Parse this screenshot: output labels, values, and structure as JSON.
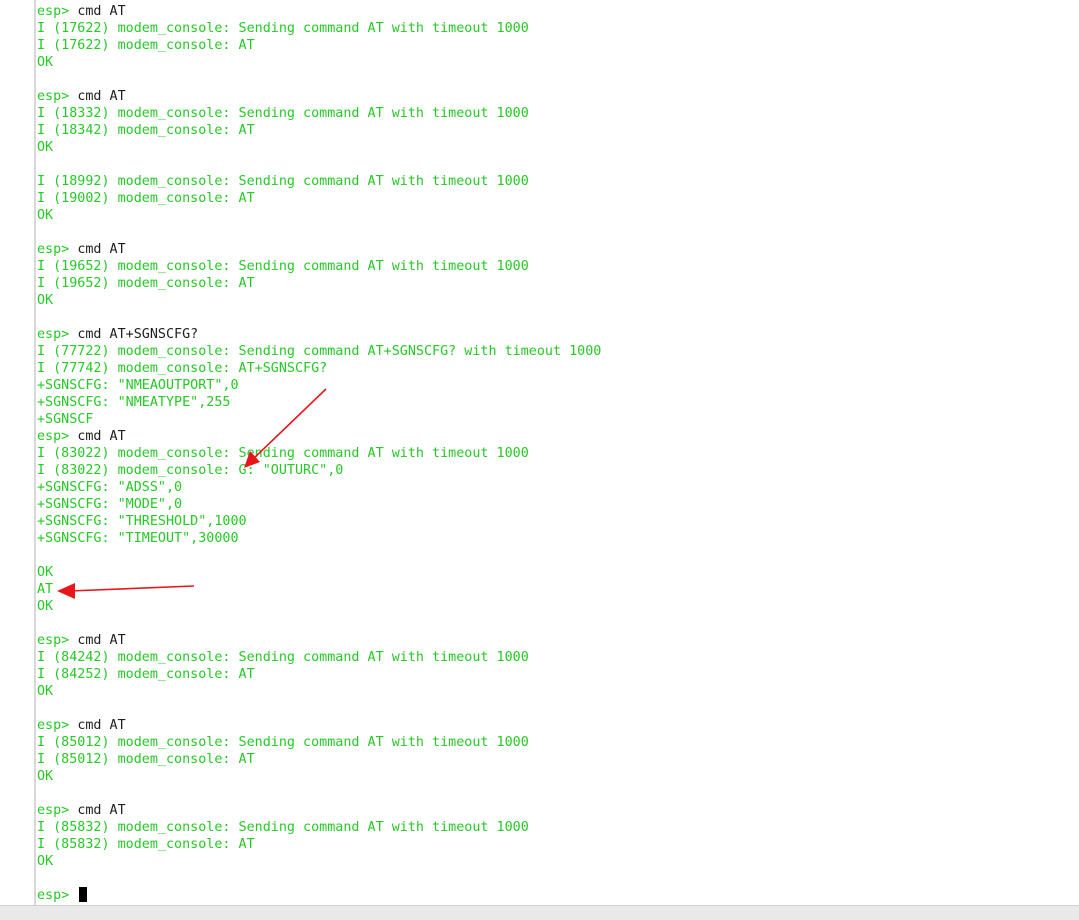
{
  "terminal": {
    "lines": [
      [
        {
          "t": "esp> ",
          "c": "green"
        },
        {
          "t": "cmd AT",
          "c": "black"
        }
      ],
      [
        {
          "t": "I (17622) modem_console: Sending command AT with timeout 1000",
          "c": "green"
        }
      ],
      [
        {
          "t": "I (17622) modem_console: AT",
          "c": "green"
        }
      ],
      [
        {
          "t": "OK",
          "c": "green"
        }
      ],
      [],
      [
        {
          "t": "esp> ",
          "c": "green"
        },
        {
          "t": "cmd AT",
          "c": "black"
        }
      ],
      [
        {
          "t": "I (18332) modem_console: Sending command AT with timeout 1000",
          "c": "green"
        }
      ],
      [
        {
          "t": "I (18342) modem_console: AT",
          "c": "green"
        }
      ],
      [
        {
          "t": "OK",
          "c": "green"
        }
      ],
      [],
      [
        {
          "t": "I (18992) modem_console: Sending command AT with timeout 1000",
          "c": "green"
        }
      ],
      [
        {
          "t": "I (19002) modem_console: AT",
          "c": "green"
        }
      ],
      [
        {
          "t": "OK",
          "c": "green"
        }
      ],
      [],
      [
        {
          "t": "esp> ",
          "c": "green"
        },
        {
          "t": "cmd AT",
          "c": "black"
        }
      ],
      [
        {
          "t": "I (19652) modem_console: Sending command AT with timeout 1000",
          "c": "green"
        }
      ],
      [
        {
          "t": "I (19652) modem_console: AT",
          "c": "green"
        }
      ],
      [
        {
          "t": "OK",
          "c": "green"
        }
      ],
      [],
      [
        {
          "t": "esp> ",
          "c": "green"
        },
        {
          "t": "cmd AT+SGNSCFG?",
          "c": "black"
        }
      ],
      [
        {
          "t": "I (77722) modem_console: Sending command AT+SGNSCFG? with timeout 1000",
          "c": "green"
        }
      ],
      [
        {
          "t": "I (77742) modem_console: AT+SGNSCFG?",
          "c": "green"
        }
      ],
      [
        {
          "t": "+SGNSCFG: \"NMEAOUTPORT\",0",
          "c": "green"
        }
      ],
      [
        {
          "t": "+SGNSCFG: \"NMEATYPE\",255",
          "c": "green"
        }
      ],
      [
        {
          "t": "+SGNSCF",
          "c": "green"
        }
      ],
      [
        {
          "t": "esp> ",
          "c": "green"
        },
        {
          "t": "cmd AT",
          "c": "black"
        }
      ],
      [
        {
          "t": "I (83022) modem_console: Sending command AT with timeout 1000",
          "c": "green"
        }
      ],
      [
        {
          "t": "I (83022) modem_console: ",
          "c": "green"
        },
        {
          "t": "G: \"OUTURC\",0",
          "c": "green"
        }
      ],
      [
        {
          "t": "+SGNSCFG: \"ADSS\",0",
          "c": "green"
        }
      ],
      [
        {
          "t": "+SGNSCFG: \"MODE\",0",
          "c": "green"
        }
      ],
      [
        {
          "t": "+SGNSCFG: \"THRESHOLD\",1000",
          "c": "green"
        }
      ],
      [
        {
          "t": "+SGNSCFG: \"TIMEOUT\",30000",
          "c": "green"
        }
      ],
      [],
      [
        {
          "t": "OK",
          "c": "green"
        }
      ],
      [
        {
          "t": "AT",
          "c": "green"
        }
      ],
      [
        {
          "t": "OK",
          "c": "green"
        }
      ],
      [],
      [
        {
          "t": "esp> ",
          "c": "green"
        },
        {
          "t": "cmd AT",
          "c": "black"
        }
      ],
      [
        {
          "t": "I (84242) modem_console: Sending command AT with timeout 1000",
          "c": "green"
        }
      ],
      [
        {
          "t": "I (84252) modem_console: AT",
          "c": "green"
        }
      ],
      [
        {
          "t": "OK",
          "c": "green"
        }
      ],
      [],
      [
        {
          "t": "esp> ",
          "c": "green"
        },
        {
          "t": "cmd AT",
          "c": "black"
        }
      ],
      [
        {
          "t": "I (85012) modem_console: Sending command AT with timeout 1000",
          "c": "green"
        }
      ],
      [
        {
          "t": "I (85012) modem_console: AT",
          "c": "green"
        }
      ],
      [
        {
          "t": "OK",
          "c": "green"
        }
      ],
      [],
      [
        {
          "t": "esp> ",
          "c": "green"
        },
        {
          "t": "cmd AT",
          "c": "black"
        }
      ],
      [
        {
          "t": "I (85832) modem_console: Sending command AT with timeout 1000",
          "c": "green"
        }
      ],
      [
        {
          "t": "I (85832) modem_console: AT",
          "c": "green"
        }
      ],
      [
        {
          "t": "OK",
          "c": "green"
        }
      ],
      [],
      [
        {
          "t": "esp> ",
          "c": "green"
        }
      ]
    ],
    "colors": {
      "green": "#26c926",
      "black": "#1f1f1f",
      "annotation": "#e8161b"
    }
  }
}
